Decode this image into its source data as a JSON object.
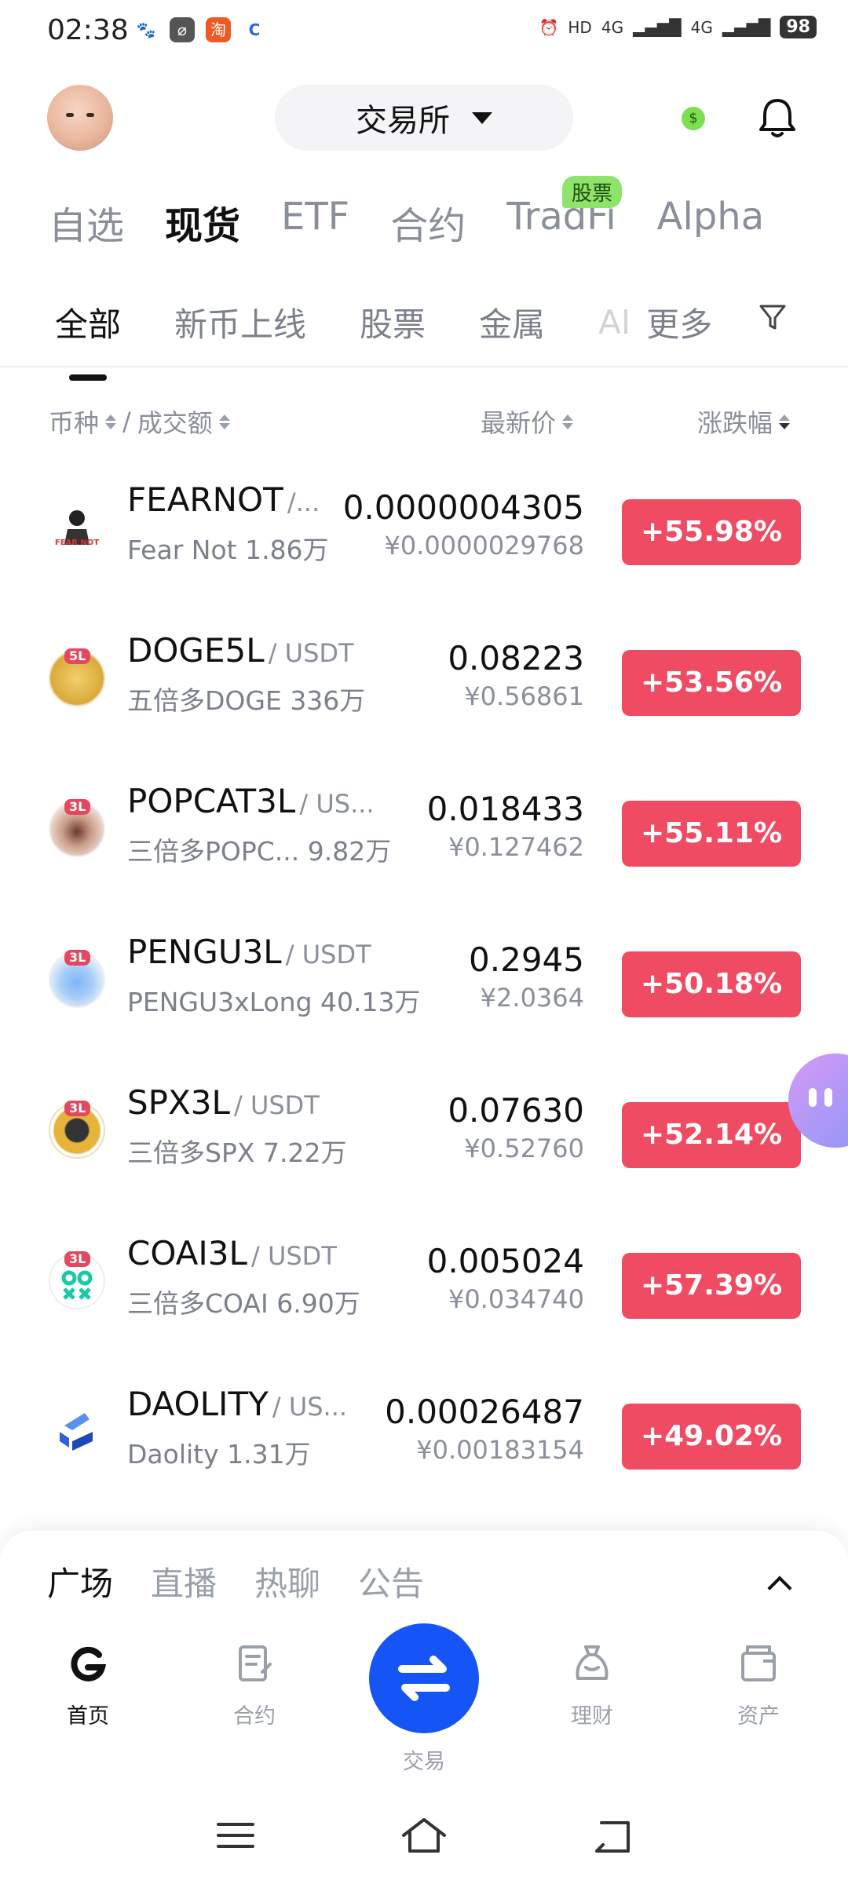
{
  "status_bar": {
    "time": "02:38",
    "network": "4G",
    "battery": "98"
  },
  "header": {
    "exchange_label": "交易所"
  },
  "main_tabs": [
    {
      "label": "自选",
      "active": false
    },
    {
      "label": "现货",
      "active": true
    },
    {
      "label": "ETF",
      "active": false
    },
    {
      "label": "合约",
      "active": false
    },
    {
      "label": "TradFi",
      "active": false,
      "badge": "股票"
    },
    {
      "label": "Alpha",
      "active": false
    }
  ],
  "sub_tabs": [
    {
      "label": "全部",
      "active": true
    },
    {
      "label": "新币上线",
      "active": false
    },
    {
      "label": "股票",
      "active": false
    },
    {
      "label": "金属",
      "active": false
    },
    {
      "label": "AI",
      "active": false,
      "faded": true
    },
    {
      "label": "更多",
      "active": false
    }
  ],
  "columns": {
    "coin": "币种",
    "separator": "/",
    "volume": "成交额",
    "price": "最新价",
    "change": "涨跌幅"
  },
  "markets": [
    {
      "base": "FEARNOT",
      "quote": "/...",
      "name": "Fear Not",
      "volume": "1.86万",
      "price": "0.0000004305",
      "price_cny": "¥0.0000029768",
      "change": "+55.98%",
      "logo_tag": ""
    },
    {
      "base": "DOGE5L",
      "quote": "/ USDT",
      "name": "五倍多DOGE",
      "volume": "336万",
      "price": "0.08223",
      "price_cny": "¥0.56861",
      "change": "+53.56%",
      "logo_tag": "5L"
    },
    {
      "base": "POPCAT3L",
      "quote": "/ US...",
      "name": "三倍多POPC...",
      "volume": "9.82万",
      "price": "0.018433",
      "price_cny": "¥0.127462",
      "change": "+55.11%",
      "logo_tag": "3L"
    },
    {
      "base": "PENGU3L",
      "quote": "/ USDT",
      "name": "PENGU3xLong",
      "volume": "40.13万",
      "price": "0.2945",
      "price_cny": "¥2.0364",
      "change": "+50.18%",
      "logo_tag": "3L"
    },
    {
      "base": "SPX3L",
      "quote": "/ USDT",
      "name": "三倍多SPX",
      "volume": "7.22万",
      "price": "0.07630",
      "price_cny": "¥0.52760",
      "change": "+52.14%",
      "logo_tag": "3L"
    },
    {
      "base": "COAI3L",
      "quote": "/ USDT",
      "name": "三倍多COAI",
      "volume": "6.90万",
      "price": "0.005024",
      "price_cny": "¥0.034740",
      "change": "+57.39%",
      "logo_tag": "3L"
    },
    {
      "base": "DAOLITY",
      "quote": "/ US...",
      "name": "Daolity",
      "volume": "1.31万",
      "price": "0.00026487",
      "price_cny": "¥0.00183154",
      "change": "+49.02%",
      "logo_tag": ""
    }
  ],
  "sheet_tabs": [
    {
      "label": "广场",
      "active": true
    },
    {
      "label": "直播",
      "active": false
    },
    {
      "label": "热聊",
      "active": false
    },
    {
      "label": "公告",
      "active": false
    }
  ],
  "bottom_nav": {
    "home": "首页",
    "futures": "合约",
    "trade": "交易",
    "earn": "理财",
    "assets": "资产"
  },
  "colors": {
    "accent": "#1554f5",
    "up": "#ef4b62",
    "badge": "#8ee36a"
  }
}
